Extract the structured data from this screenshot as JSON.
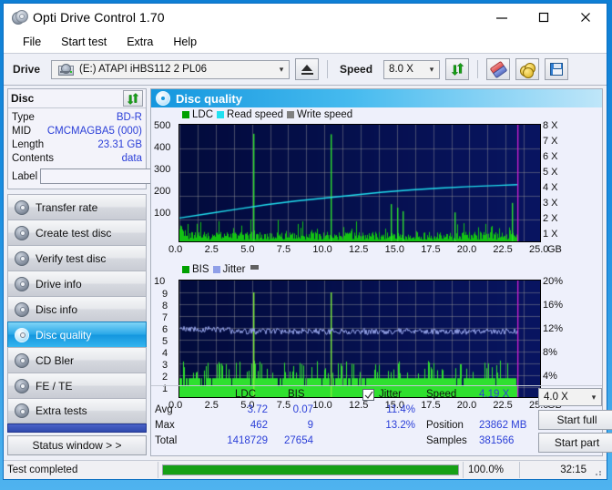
{
  "window": {
    "title": "Opti Drive Control 1.70",
    "icon": "disc-stack-icon",
    "minimize": "minimize-icon",
    "maximize": "maximize-icon",
    "close": "close-icon"
  },
  "menu": {
    "items": [
      "File",
      "Start test",
      "Extra",
      "Help"
    ]
  },
  "toolbar": {
    "drive_label": "Drive",
    "drive_value": "(E:)   ATAPI iHBS112   2 PL06",
    "eject_title": "Eject",
    "speed_label": "Speed",
    "speed_value": "8.0 X",
    "refresh_title": "Refresh",
    "erase_title": "Erase",
    "settings_title": "Settings",
    "save_title": "Save"
  },
  "disc": {
    "header": "Disc",
    "refresh_title": "Refresh disc info",
    "rows": [
      {
        "key": "Type",
        "value": "BD-R"
      },
      {
        "key": "MID",
        "value": "CMCMAGBA5 (000)"
      },
      {
        "key": "Length",
        "value": "23.31 GB"
      },
      {
        "key": "Contents",
        "value": "data"
      }
    ],
    "label_key": "Label",
    "label_value": "",
    "label_button_title": "Set label"
  },
  "sidebar": {
    "items": [
      {
        "label": "Transfer rate",
        "active": false
      },
      {
        "label": "Create test disc",
        "active": false
      },
      {
        "label": "Verify test disc",
        "active": false
      },
      {
        "label": "Drive info",
        "active": false
      },
      {
        "label": "Disc info",
        "active": false
      },
      {
        "label": "Disc quality",
        "active": true
      },
      {
        "label": "CD Bler",
        "active": false
      },
      {
        "label": "FE / TE",
        "active": false
      },
      {
        "label": "Extra tests",
        "active": false
      }
    ],
    "status_window": "Status window > >"
  },
  "main": {
    "title": "Disc quality",
    "speed_select": "4.0 X",
    "start_full": "Start full",
    "start_part": "Start part"
  },
  "stats": {
    "col_ldc": "LDC",
    "col_bis": "BIS",
    "jitter_label": "Jitter",
    "jitter_checked": true,
    "rows": [
      {
        "label": "Avg",
        "ldc": "3.72",
        "bis": "0.07",
        "jitter": "11.4%"
      },
      {
        "label": "Max",
        "ldc": "462",
        "bis": "9",
        "jitter": "13.2%"
      },
      {
        "label": "Total",
        "ldc": "1418729",
        "bis": "27654",
        "jitter": ""
      }
    ],
    "speed_label": "Speed",
    "speed_value": "4.19 X",
    "position_label": "Position",
    "position_value": "23862 MB",
    "samples_label": "Samples",
    "samples_value": "381566"
  },
  "statusbar": {
    "message": "Test completed",
    "percent_text": "100.0%",
    "percent_value": 100,
    "elapsed": "32:15"
  },
  "chart_data": [
    {
      "type": "line",
      "id": "ldc-chart",
      "title": "",
      "xlabel": "GB",
      "ylabel": "",
      "xlim": [
        0,
        25
      ],
      "xticks": [
        "0.0",
        "2.5",
        "5.0",
        "7.5",
        "10.0",
        "12.5",
        "15.0",
        "17.5",
        "20.0",
        "22.5",
        "25.0"
      ],
      "xunit": "GB",
      "ylim": [
        0,
        500
      ],
      "yticks": [
        "100",
        "200",
        "300",
        "400",
        "500"
      ],
      "y2lim": [
        0,
        8
      ],
      "y2ticks": [
        "1 X",
        "2 X",
        "3 X",
        "4 X",
        "5 X",
        "6 X",
        "7 X",
        "8 X"
      ],
      "grid": true,
      "legend": [
        {
          "name": "LDC",
          "color": "#00a000"
        },
        {
          "name": "Read speed",
          "color": "#20e0f0"
        },
        {
          "name": "Write speed",
          "color": "#808080"
        }
      ],
      "series": [
        {
          "name": "Read speed",
          "color": "#20e0f0",
          "axis": "right",
          "x": [
            0,
            2,
            4,
            6,
            8,
            10,
            12,
            14,
            16,
            18,
            20,
            22,
            23.3
          ],
          "values": [
            1.7,
            2.0,
            2.3,
            2.6,
            2.85,
            3.05,
            3.25,
            3.45,
            3.6,
            3.72,
            3.82,
            3.9,
            3.95
          ]
        },
        {
          "name": "LDC",
          "color": "#00c000",
          "axis": "left",
          "note": "dense error spikes along disc; baseline near 20-60, spikes to 462 max",
          "peaks": [
            {
              "x": 5.1,
              "y": 462
            },
            {
              "x": 10.4,
              "y": 460
            },
            {
              "x": 14.6,
              "y": 165
            },
            {
              "x": 15.0,
              "y": 150
            },
            {
              "x": 15.4,
              "y": 135
            },
            {
              "x": 19.0,
              "y": 130
            },
            {
              "x": 22.9,
              "y": 170
            }
          ],
          "baseline_avg": 3.72
        }
      ],
      "markers": [
        {
          "name": "disc-end",
          "x": 23.3,
          "color": "#d020d0"
        }
      ]
    },
    {
      "type": "line",
      "id": "bis-jitter-chart",
      "title": "",
      "xlabel": "GB",
      "xlim": [
        0,
        25
      ],
      "xticks": [
        "0.0",
        "2.5",
        "5.0",
        "7.5",
        "10.0",
        "12.5",
        "15.0",
        "17.5",
        "20.0",
        "22.5",
        "25.0"
      ],
      "xunit": "GB",
      "ylim": [
        0,
        10
      ],
      "yticks": [
        "1",
        "2",
        "3",
        "4",
        "5",
        "6",
        "7",
        "8",
        "9",
        "10"
      ],
      "y2lim": [
        0,
        20
      ],
      "y2ticks": [
        "4%",
        "8%",
        "12%",
        "16%",
        "20%"
      ],
      "grid": true,
      "legend": [
        {
          "name": "BIS",
          "color": "#00a000"
        },
        {
          "name": "Jitter",
          "color": "#8f9fe8"
        },
        {
          "name": "",
          "color": "#606060"
        }
      ],
      "series": [
        {
          "name": "BIS",
          "color": "#30d030",
          "axis": "left",
          "note": "dense green fill to ~1.8 with spikes to 3; two tall spikes to 9",
          "peaks": [
            {
              "x": 5.1,
              "y": 9
            },
            {
              "x": 10.4,
              "y": 9
            }
          ],
          "baseline_avg": 0.07,
          "max": 9
        },
        {
          "name": "Jitter",
          "color": "#9aa8ee",
          "axis": "right",
          "note": "noisy flat line around 11.4% average, max 13.2%",
          "avg_pct": 11.4,
          "max_pct": 13.2
        }
      ],
      "markers": [
        {
          "name": "disc-end",
          "x": 23.3,
          "color": "#d020d0"
        }
      ]
    }
  ]
}
